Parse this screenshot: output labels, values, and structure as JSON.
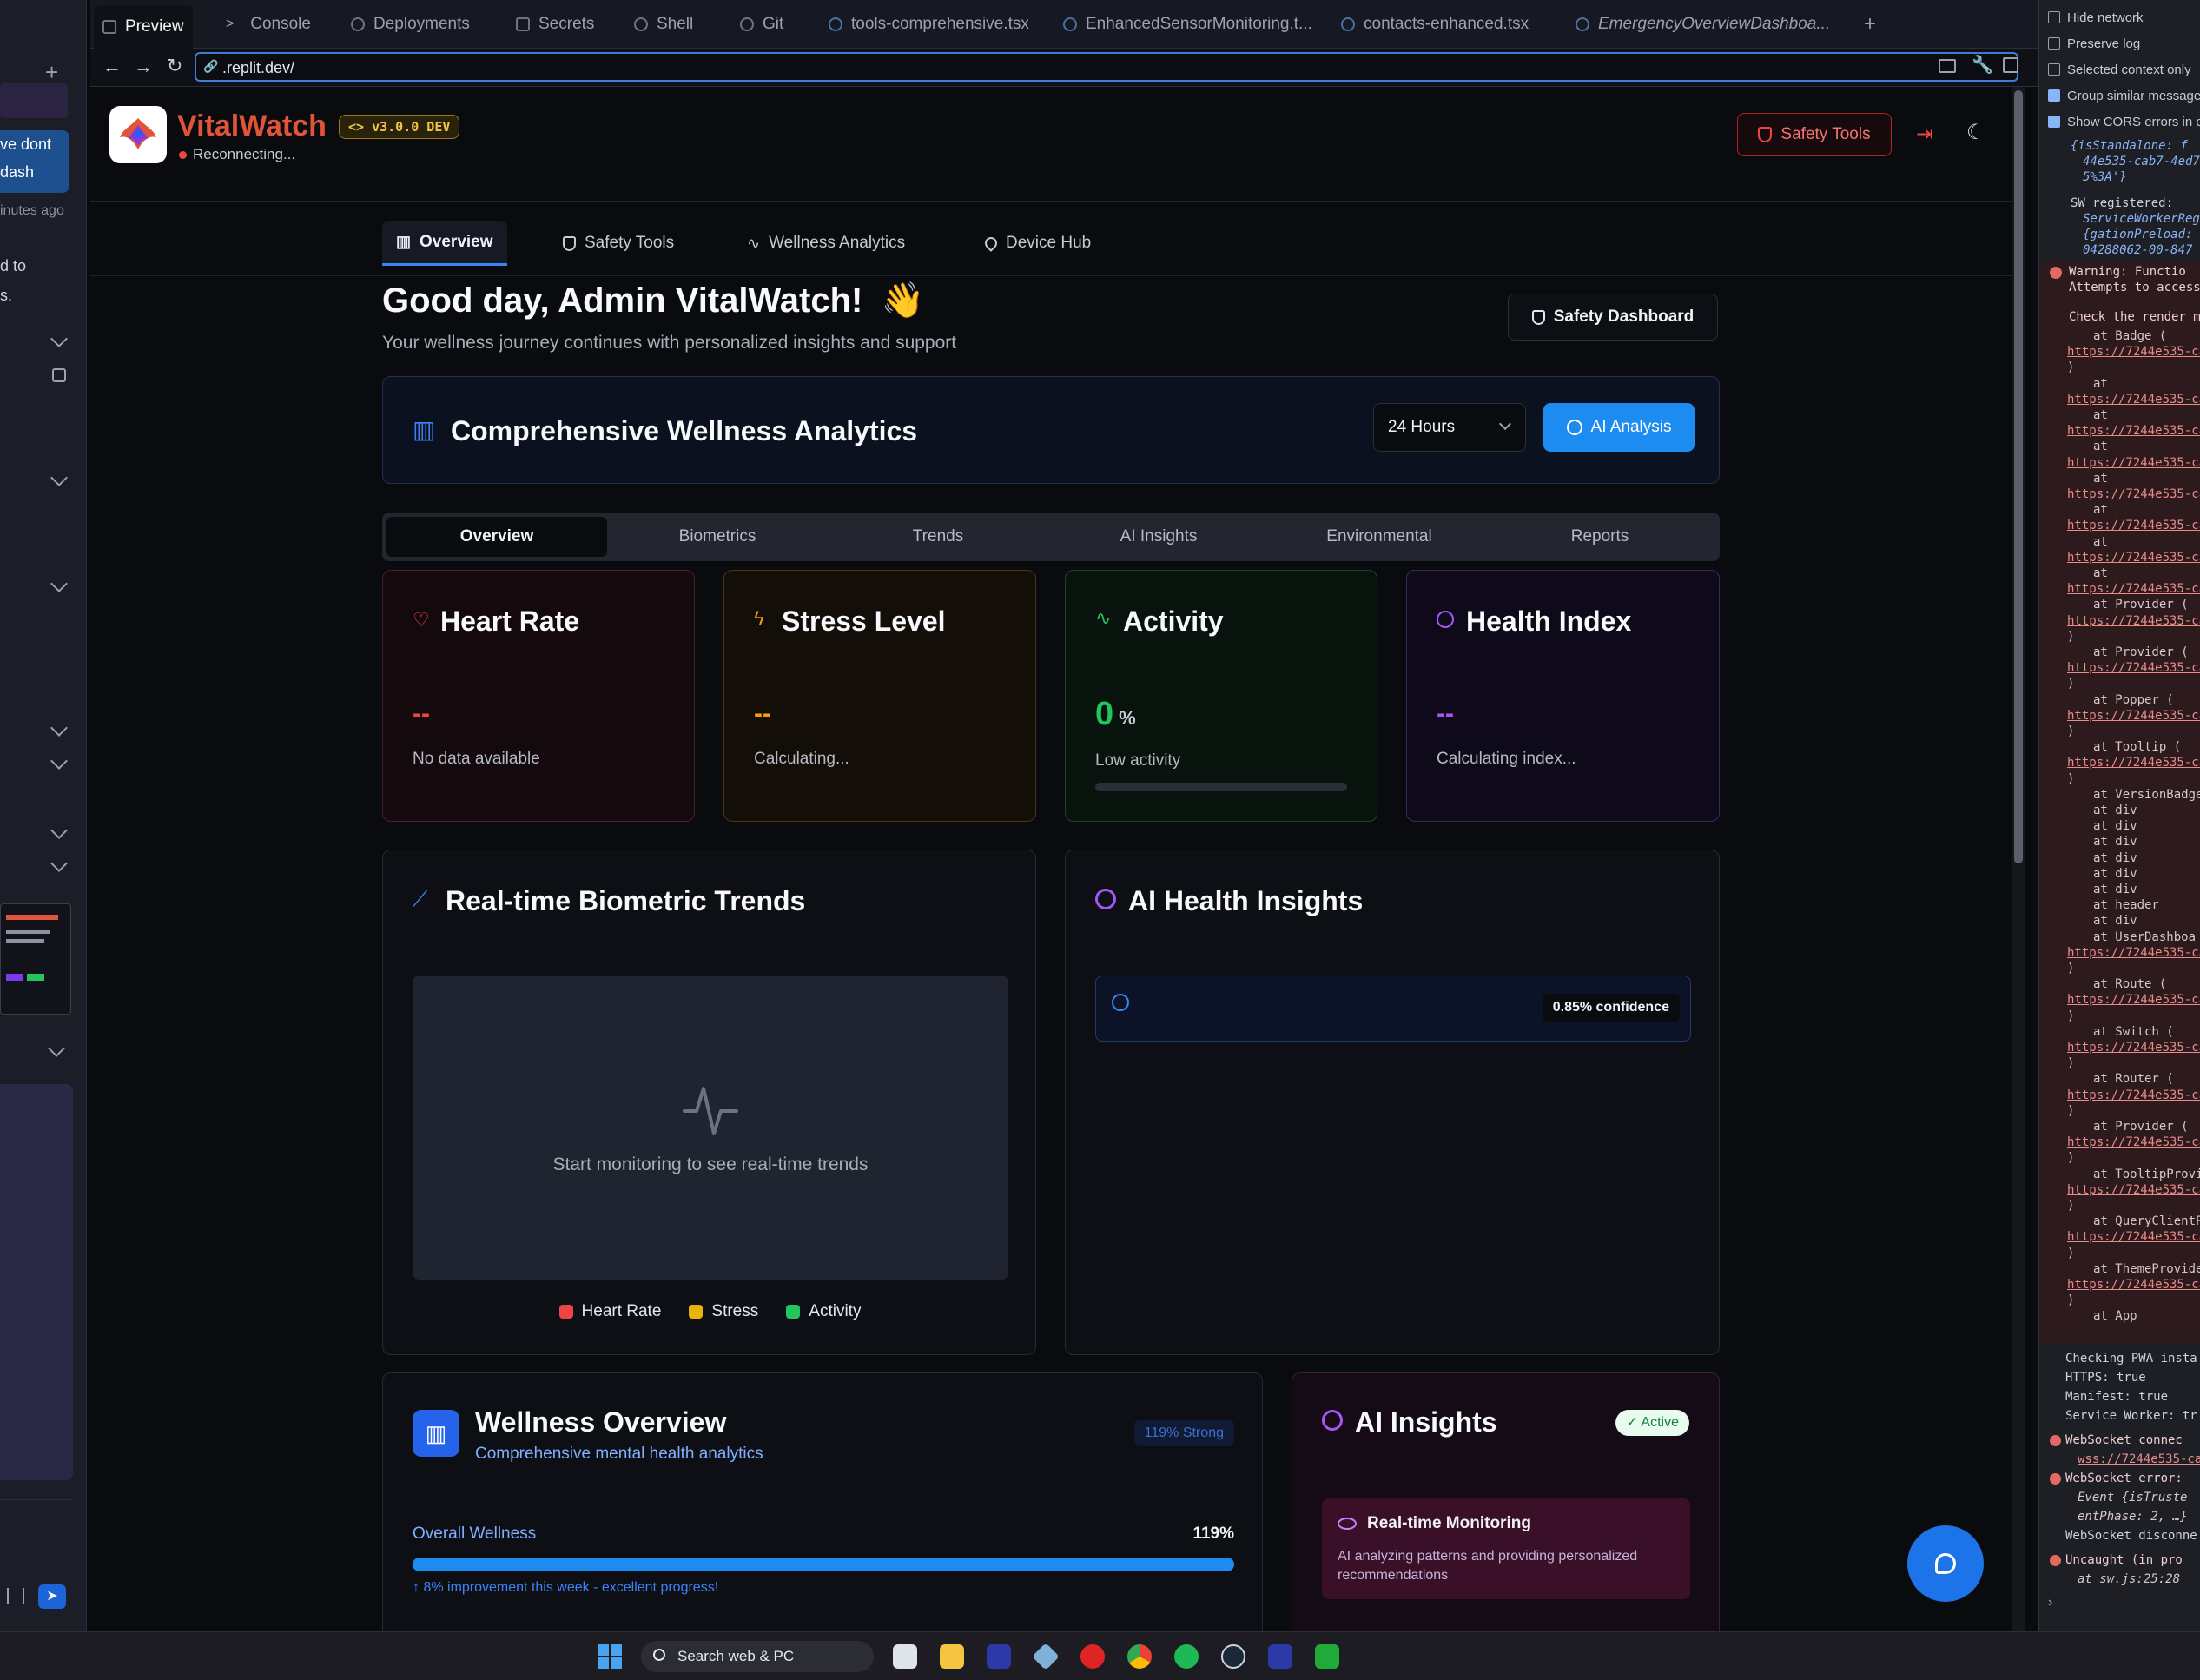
{
  "tabs": [
    {
      "label": "Preview",
      "active": true
    },
    {
      "label": "Console"
    },
    {
      "label": "Deployments"
    },
    {
      "label": "Secrets"
    },
    {
      "label": "Shell"
    },
    {
      "label": "Git"
    },
    {
      "label": "tools-comprehensive.tsx"
    },
    {
      "label": "EnhancedSensorMonitoring.t..."
    },
    {
      "label": "contacts-enhanced.tsx"
    },
    {
      "label": "EmergencyOverviewDashboa..."
    }
  ],
  "url": ".replit.dev/",
  "left_sidebar": {
    "texts": [
      "ve dont",
      "dash",
      "inutes ago",
      "d to",
      "s."
    ]
  },
  "header": {
    "brand": "VitalWatch",
    "version_badge": "v3.0.0 DEV",
    "status": "Reconnecting...",
    "safety_tools_btn": "Safety Tools"
  },
  "nav": [
    {
      "label": "Overview",
      "icon": "bar-chart-icon",
      "active": true
    },
    {
      "label": "Safety Tools",
      "icon": "shield-icon"
    },
    {
      "label": "Wellness Analytics",
      "icon": "pulse-icon"
    },
    {
      "label": "Device Hub",
      "icon": "map-pin-icon"
    }
  ],
  "greeting": {
    "title": "Good day, Admin VitalWatch!",
    "emoji": "👋",
    "subtitle": "Your wellness journey continues with personalized insights and support",
    "safety_dashboard_btn": "Safety Dashboard"
  },
  "analytics": {
    "title": "Comprehensive Wellness Analytics",
    "range": "24 Hours",
    "ai_btn": "AI Analysis",
    "subtabs": [
      "Overview",
      "Biometrics",
      "Trends",
      "AI Insights",
      "Environmental",
      "Reports"
    ],
    "active_subtab": "Overview"
  },
  "metrics": [
    {
      "title": "Heart Rate",
      "value": "--",
      "caption": "No data available",
      "color": "#ef4444"
    },
    {
      "title": "Stress Level",
      "value": "--",
      "caption": "Calculating...",
      "color": "#f59e0b"
    },
    {
      "title": "Activity",
      "value": "0",
      "unit": "%",
      "caption": "Low activity",
      "color": "#22c55e",
      "progress": 0
    },
    {
      "title": "Health Index",
      "value": "--",
      "caption": "Calculating index...",
      "color": "#a855f7"
    }
  ],
  "trends": {
    "title": "Real-time Biometric Trends",
    "empty": "Start monitoring to see real-time trends",
    "legend": [
      {
        "label": "Heart Rate",
        "color": "#ef4444"
      },
      {
        "label": "Stress",
        "color": "#eab308"
      },
      {
        "label": "Activity",
        "color": "#22c55e"
      }
    ]
  },
  "health_insights": {
    "title": "AI Health Insights",
    "confidence": "0.85% confidence"
  },
  "wellness": {
    "title": "Wellness Overview",
    "subtitle": "Comprehensive mental health analytics",
    "badge": "119% Strong",
    "overall_label": "Overall Wellness",
    "overall_value": "119%",
    "overall_progress": 1.0,
    "note": "↑ 8% improvement this week - excellent progress!"
  },
  "ai_insights": {
    "title": "AI Insights",
    "badge": "Active",
    "item_title": "Real-time Monitoring",
    "item_text": "AI analyzing patterns and providing personalized recommendations"
  },
  "devtools": {
    "options": [
      {
        "label": "Hide network",
        "checked": false
      },
      {
        "label": "Preserve log",
        "checked": false
      },
      {
        "label": "Selected context only",
        "checked": false
      },
      {
        "label": "Group similar messages",
        "checked": true
      },
      {
        "label": "Show CORS errors in co",
        "checked": true
      }
    ],
    "top_lines": [
      "{isStandalone: f",
      "44e535-cab7-4ed7",
      "5%3A'}",
      "SW registered:",
      "ServiceWorkerReg",
      "{gationPreload:",
      "04288062-00-847"
    ],
    "warning_title": "Warning: Functio",
    "warning_sub": "Attempts to access",
    "warning_check": "Check the render me",
    "stack": [
      "at Badge (",
      "https://7244e535-ca",
      ")",
      "at",
      "https://7244e535-ca",
      "at",
      "https://7244e535-ca",
      "at",
      "https://7244e535-ca",
      "at",
      "https://7244e535-ca",
      "at",
      "https://7244e535-ca",
      "at",
      "https://7244e535-ca",
      "at",
      "https://7244e535-ca",
      "at Provider (",
      "https://7244e535-ca",
      ")",
      "at Provider (",
      "https://7244e535-ca",
      ")",
      "at Popper (",
      "https://7244e535-ca",
      ")",
      "at Tooltip (",
      "https://7244e535-ca",
      ")",
      "at VersionBadge",
      "at div",
      "at div",
      "at div",
      "at div",
      "at div",
      "at div",
      "at header",
      "at div",
      "at UserDashboa",
      "https://7244e535-ca",
      ")",
      "at Route (",
      "https://7244e535-ca",
      ")",
      "at Switch (",
      "https://7244e535-ca",
      ")",
      "at Router (",
      "https://7244e535-ca",
      ")",
      "at Provider (",
      "https://7244e535-ca",
      ")",
      "at TooltipProvi",
      "https://7244e535-ca",
      ")",
      "at QueryClientP",
      "https://7244e535-ca",
      ")",
      "at ThemeProvide",
      "https://7244e535-ca",
      ")",
      "at App"
    ],
    "bottom_lines": [
      {
        "text": "Checking PWA insta",
        "type": "info"
      },
      {
        "text": "HTTPS: true",
        "type": "info"
      },
      {
        "text": "Manifest: true",
        "type": "info"
      },
      {
        "text": "Service Worker: tr",
        "type": "info"
      },
      {
        "text": "WebSocket connec",
        "type": "error"
      },
      {
        "text": "wss://7244e535-cab",
        "type": "link"
      },
      {
        "text": "WebSocket error:",
        "type": "error"
      },
      {
        "text": "Event {isTruste",
        "type": "sub"
      },
      {
        "text": "entPhase: 2, …}",
        "type": "sub"
      },
      {
        "text": "WebSocket disconne",
        "type": "info"
      },
      {
        "text": "Uncaught (in pro",
        "type": "error"
      },
      {
        "text": "at sw.js:25:28",
        "type": "sub"
      }
    ]
  },
  "taskbar": {
    "search": "Search web & PC"
  }
}
